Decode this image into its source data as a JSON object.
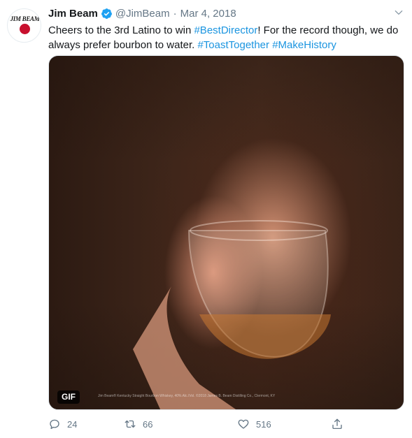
{
  "tweet": {
    "avatar": {
      "brand_text": "JIM BEAM",
      "icon": "jim-beam-logo-icon"
    },
    "author": {
      "name": "Jim Beam",
      "handle": "@JimBeam",
      "verified_icon": "verified-badge-icon"
    },
    "separator": "·",
    "date": "Mar 4, 2018",
    "menu_icon": "chevron-down-icon",
    "text": {
      "part1": "Cheers to the 3rd Latino to win ",
      "hashtag1": "#BestDirector",
      "part2": "! For the record though, we do always prefer bourbon to water. ",
      "hashtag2": "#ToastTogether",
      "space": " ",
      "hashtag3": "#MakeHistory"
    },
    "media": {
      "type": "gif",
      "badge": "GIF",
      "fineprint": "Jim Beam® Kentucky Straight Bourbon Whiskey, 40% Alc./Vol. ©2018 James B. Beam Distilling Co., Clermont, KY"
    },
    "actions": {
      "reply": {
        "icon": "reply-icon",
        "count": "24"
      },
      "retweet": {
        "icon": "retweet-icon",
        "count": "66"
      },
      "like": {
        "icon": "heart-icon",
        "count": "516"
      },
      "share": {
        "icon": "share-icon"
      }
    }
  },
  "colors": {
    "link": "#1b95e0",
    "secondary_text": "#657786",
    "primary_text": "#14171a",
    "verified": "#1da1f2",
    "brand_red": "#c8102e"
  }
}
